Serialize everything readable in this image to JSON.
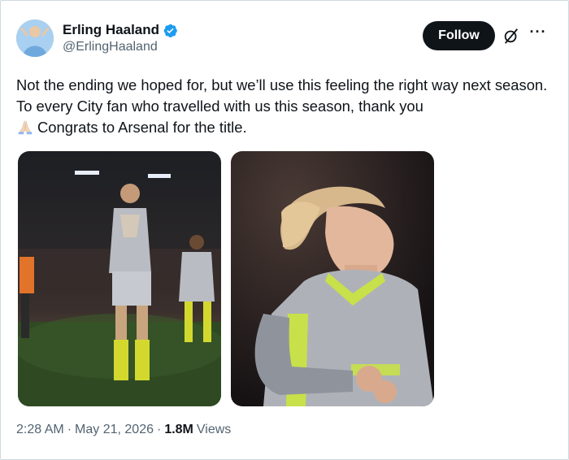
{
  "author": {
    "display_name": "Erling Haaland",
    "handle": "@ErlingHaaland",
    "verified": true
  },
  "actions": {
    "follow_label": "Follow",
    "grok_icon": "grok-icon",
    "more_icon": "more-icon"
  },
  "tweet": {
    "line1": "Not the ending we hoped for, but we’ll use this feeling the right way next season. To every City fan who travelled with us this season, thank you",
    "line2": "Congrats to Arsenal for the title.",
    "emoji": "folded-hands-emoji"
  },
  "media": [
    {
      "alt_icon": "photo-player-applauding"
    },
    {
      "alt_icon": "photo-player-closeup"
    }
  ],
  "meta": {
    "time": "2:28 AM",
    "date": "May 21, 2026",
    "views_count": "1.8M",
    "views_label": "Views"
  },
  "colors": {
    "text": "#0f1419",
    "secondary": "#536471",
    "verified": "#1d9bf0",
    "follow_bg": "#0f1419"
  }
}
